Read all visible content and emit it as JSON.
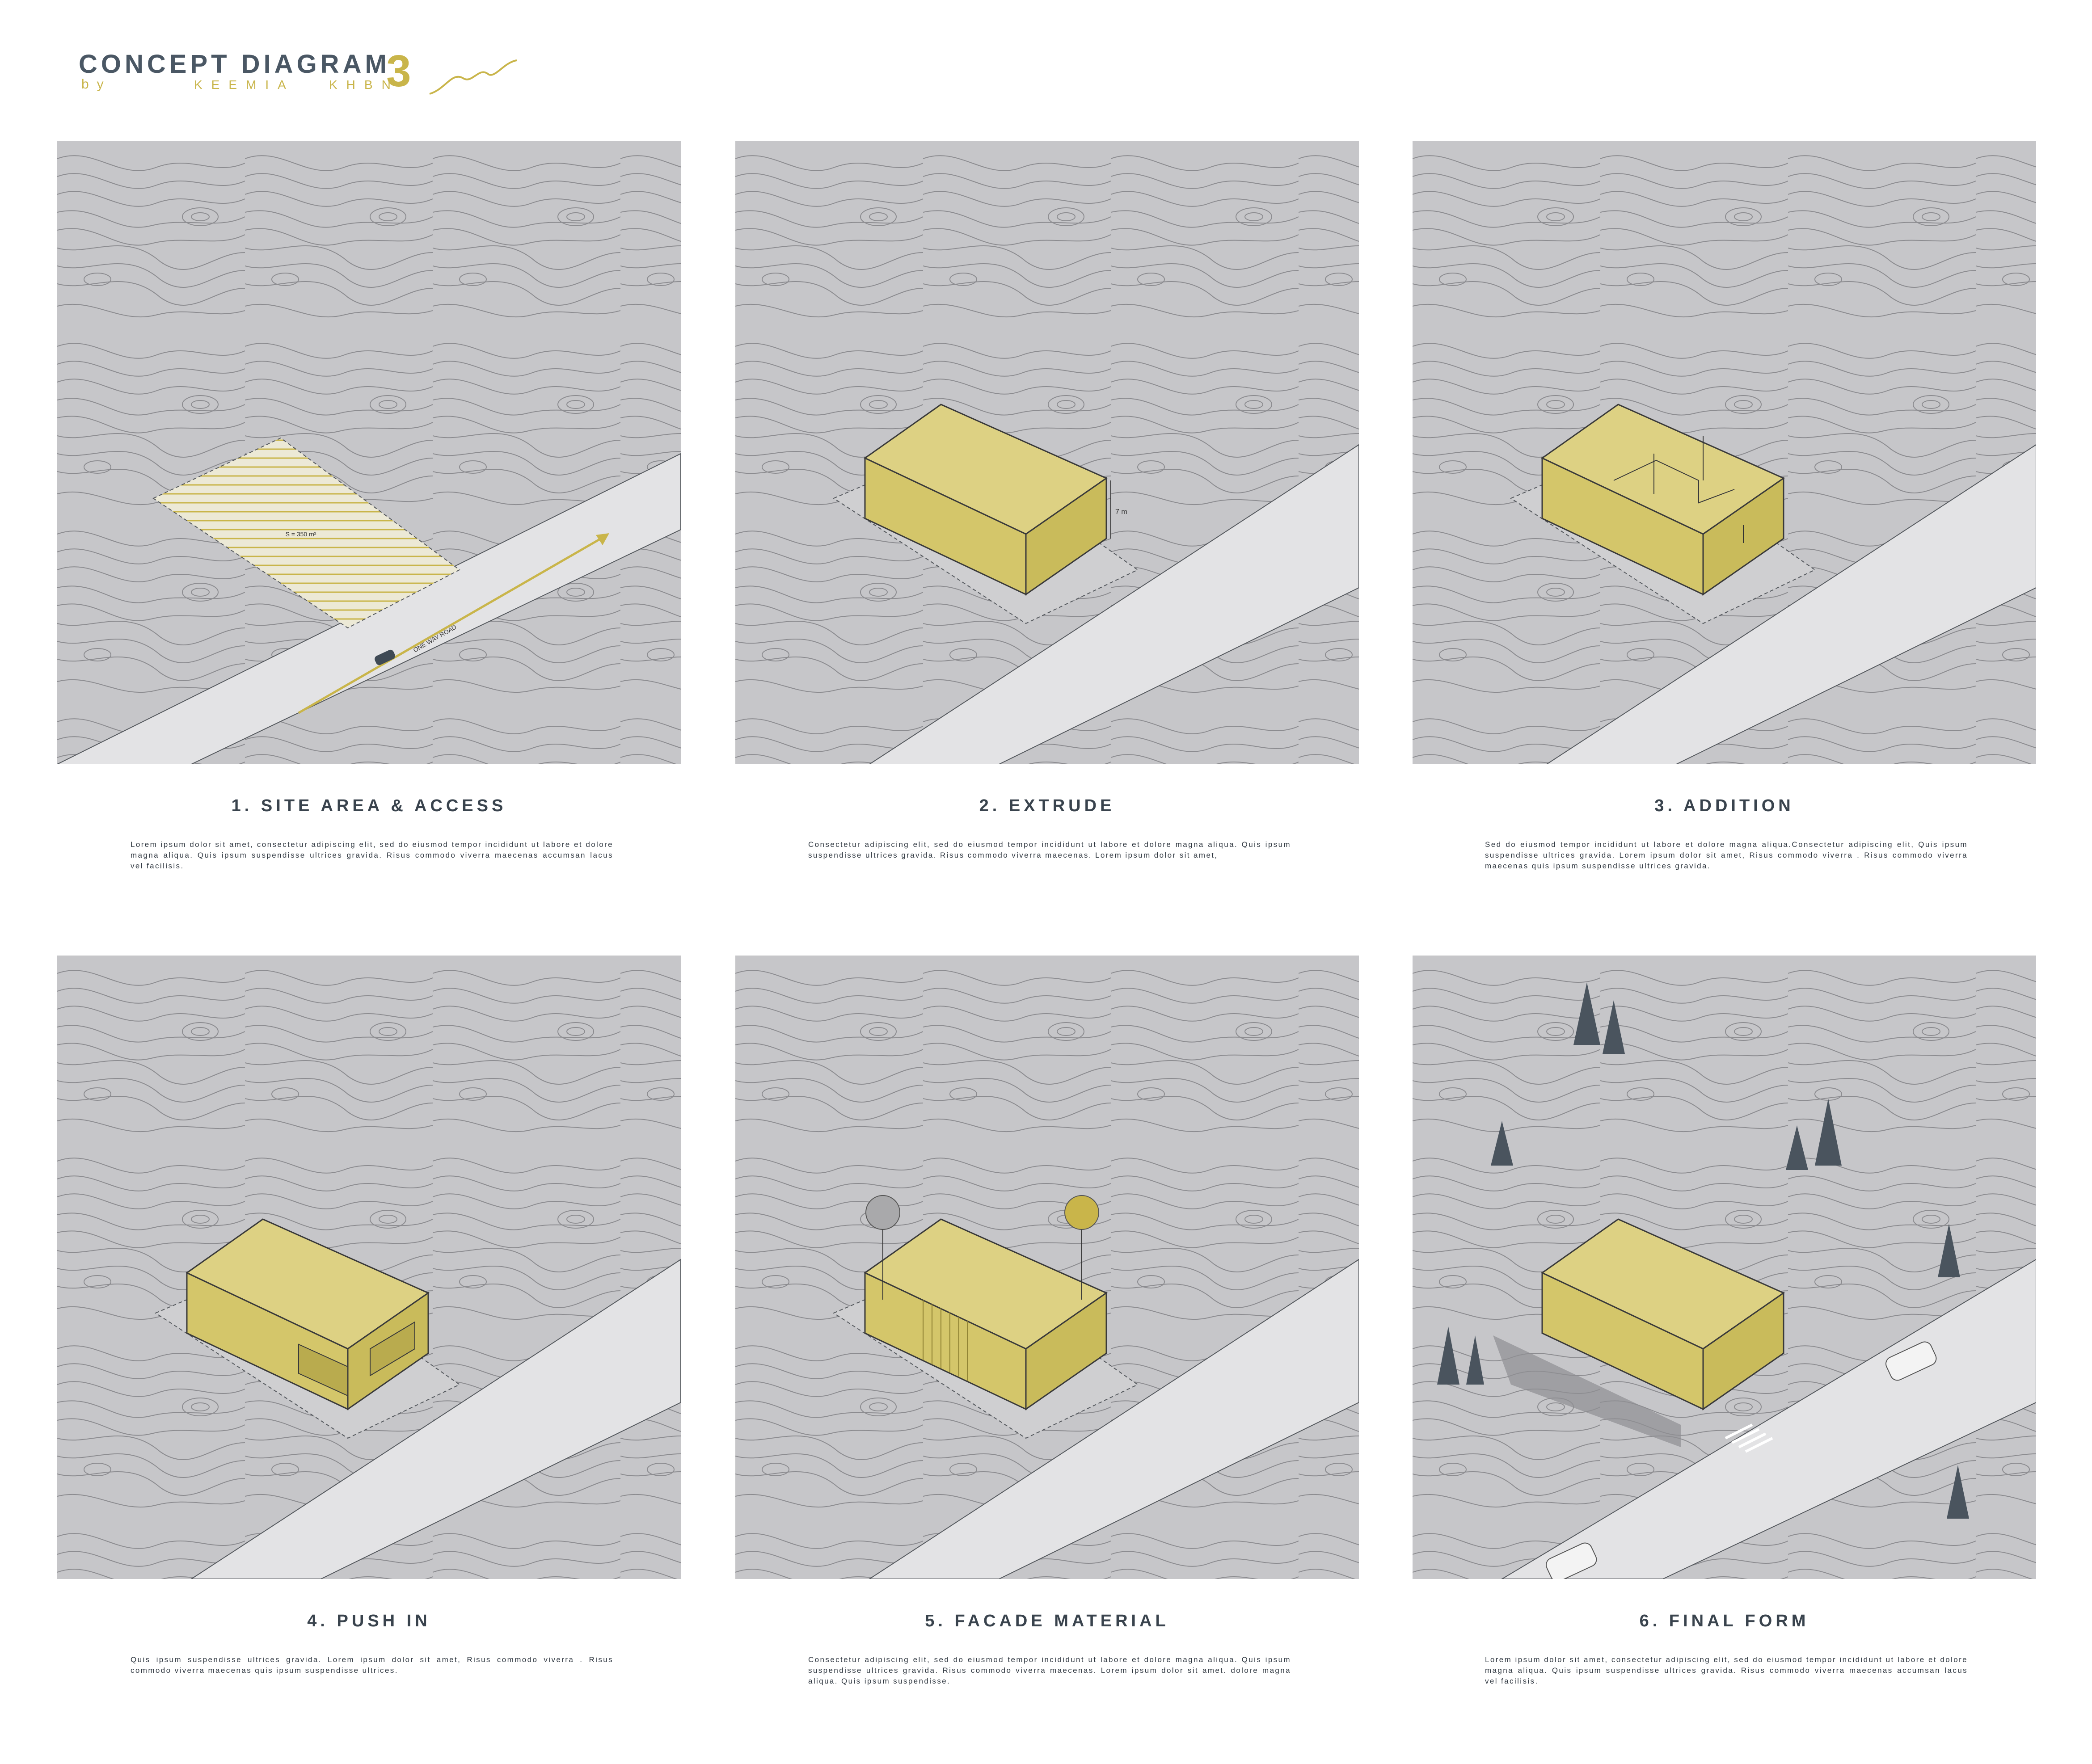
{
  "header": {
    "title": "CONCEPT DIAGRAM",
    "number": "3",
    "by": "by",
    "author_first": "KEEMIA",
    "author_last": "KHBN"
  },
  "colors": {
    "accent_yellow": "#d4c66a",
    "accent_gold": "#c9b54a",
    "terrain": "#c6c6c9",
    "road": "#e3e3e5",
    "text_dark": "#39434d"
  },
  "steps": [
    {
      "title": "1. SITE AREA & ACCESS",
      "description": "Lorem ipsum dolor sit amet, consectetur adipiscing elit, sed do eiusmod tempor incididunt ut labore et dolore magna aliqua. Quis ipsum suspendisse ultrices gravida. Risus commodo viverra maecenas accumsan lacus vel facilisis.",
      "labels": {
        "area": "S = 350 m²",
        "road": "ONE WAY ROAD"
      }
    },
    {
      "title": "2. EXTRUDE",
      "description": "Consectetur adipiscing elit, sed do eiusmod tempor incididunt ut labore et dolore magna aliqua. Quis ipsum suspendisse ultrices gravida. Risus commodo viverra maecenas. Lorem ipsum dolor sit amet,",
      "labels": {
        "height": "7 m"
      }
    },
    {
      "title": "3. ADDITION",
      "description": "Sed do eiusmod tempor incididunt ut labore et dolore magna aliqua.Consectetur adipiscing elit, Quis ipsum suspendisse ultrices gravida. Lorem ipsum dolor sit amet, Risus commodo viverra . Risus commodo viverra maecenas quis ipsum suspendisse ultrices gravida."
    },
    {
      "title": "4. PUSH IN",
      "description": "Quis ipsum suspendisse ultrices gravida. Lorem ipsum dolor sit amet, Risus commodo viverra . Risus commodo viverra maecenas quis ipsum suspendisse ultrices."
    },
    {
      "title": "5. FACADE MATERIAL",
      "description": "Consectetur adipiscing elit, sed do eiusmod tempor incididunt ut labore et dolore magna aliqua. Quis ipsum suspendisse ultrices gravida. Risus commodo viverra maecenas. Lorem ipsum dolor sit amet. dolore magna aliqua. Quis ipsum suspendisse."
    },
    {
      "title": "6. FINAL FORM",
      "description": "Lorem ipsum dolor sit amet, consectetur adipiscing elit, sed do eiusmod tempor incididunt ut labore et dolore magna aliqua. Quis ipsum suspendisse ultrices gravida. Risus commodo viverra maecenas accumsan lacus vel facilisis."
    }
  ]
}
